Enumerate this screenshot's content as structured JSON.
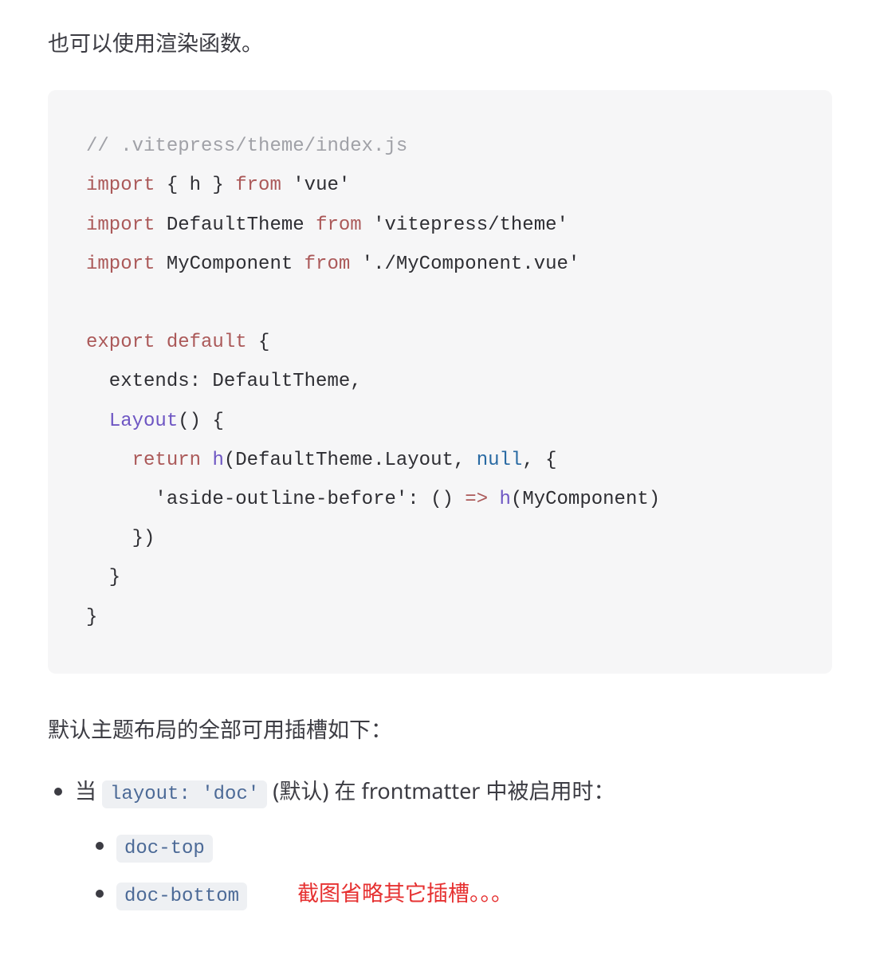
{
  "intro": "也可以使用渲染函数。",
  "code": {
    "l1_comment": "// .vitepress/theme/index.js",
    "l2_import": "import",
    "l2_braces": " { h } ",
    "l2_from": "from",
    "l2_pkg": " 'vue'",
    "l3_import": "import",
    "l3_name": " DefaultTheme ",
    "l3_from": "from",
    "l3_pkg": " 'vitepress/theme'",
    "l4_import": "import",
    "l4_name": " MyComponent ",
    "l4_from": "from",
    "l4_pkg": " './MyComponent.vue'",
    "l6_export": "export",
    "l6_default": " default",
    "l6_brace": " {",
    "l7": "  extends: DefaultTheme,",
    "l8_indent": "  ",
    "l8_func": "Layout",
    "l8_rest": "() {",
    "l9_indent": "    ",
    "l9_return": "return",
    "l9_sp": " ",
    "l9_h": "h",
    "l9_rest1": "(DefaultTheme.Layout, ",
    "l9_null": "null",
    "l9_rest2": ", {",
    "l10_indent": "      ",
    "l10_key": "'aside-outline-before'",
    "l10_colon": ": () ",
    "l10_arrow": "=>",
    "l10_sp": " ",
    "l10_h": "h",
    "l10_rest": "(MyComponent)",
    "l11": "    })",
    "l12": "  }",
    "l13": "}"
  },
  "slots_intro": "默认主题布局的全部可用插槽如下：",
  "list": {
    "item1_prefix": "当 ",
    "item1_code": "layout: 'doc'",
    "item1_suffix": " (默认) 在 frontmatter 中被启用时：",
    "sub1": "doc-top",
    "sub2": "doc-bottom",
    "note": "截图省略其它插槽。。。"
  }
}
